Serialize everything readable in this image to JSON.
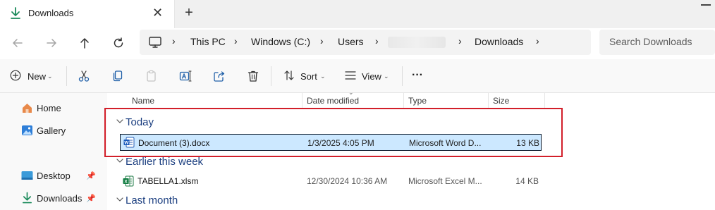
{
  "tab": {
    "title": "Downloads",
    "close": "✕",
    "new_tab": "+"
  },
  "address": {
    "crumbs": [
      "This PC",
      "Windows (C:)",
      "Users",
      "Downloads"
    ],
    "search_placeholder": "Search Downloads"
  },
  "commands": {
    "new_label": "New",
    "sort_label": "Sort",
    "view_label": "View",
    "more_label": "···"
  },
  "sidebar": {
    "items": [
      {
        "label": "Home",
        "icon": "home-icon"
      },
      {
        "label": "Gallery",
        "icon": "gallery-icon"
      },
      {
        "label": "Desktop",
        "icon": "desktop-icon",
        "pinned": true
      },
      {
        "label": "Downloads",
        "icon": "download-icon",
        "pinned": true
      }
    ]
  },
  "columns": [
    "Name",
    "Date modified",
    "Type",
    "Size"
  ],
  "groups": [
    {
      "label": "Today",
      "files": [
        {
          "name": "Document (3).docx",
          "date": "1/3/2025 4:05 PM",
          "type": "Microsoft Word D...",
          "size": "13 KB",
          "selected": true,
          "icon": "word-doc-icon"
        }
      ]
    },
    {
      "label": "Earlier this week",
      "files": [
        {
          "name": "TABELLA1.xlsm",
          "date": "12/30/2024 10:36 AM",
          "type": "Microsoft Excel M...",
          "size": "14 KB",
          "selected": false,
          "icon": "excel-doc-icon"
        }
      ]
    },
    {
      "label": "Last month",
      "files": []
    }
  ],
  "colors": {
    "accent": "#0067c0",
    "selection": "#cce8ff",
    "highlight": "#d21f2a",
    "group_text": "#1c3f80"
  }
}
